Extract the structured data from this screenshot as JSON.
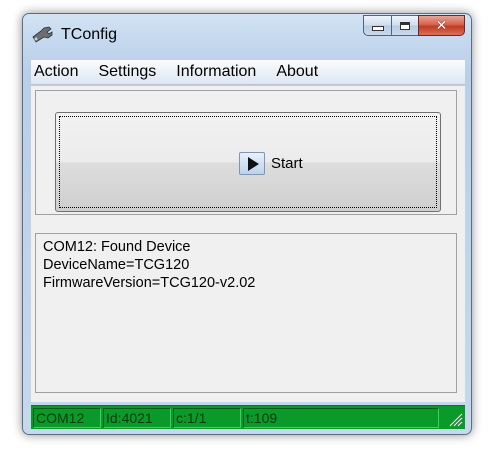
{
  "window": {
    "title": "TConfig",
    "app_icon": "wrench-icon",
    "close_glyph": "✕"
  },
  "menu": {
    "items": [
      "Action",
      "Settings",
      "Information",
      "About"
    ]
  },
  "start_button": {
    "label": "Start",
    "icon": "play-icon"
  },
  "log": {
    "lines": [
      "COM12: Found Device",
      "DeviceName=TCG120",
      "FirmwareVersion=TCG120-v2.02"
    ]
  },
  "status": {
    "cells": [
      "COM12",
      "Id:4021",
      "c:1/1",
      "t:109"
    ]
  },
  "colors": {
    "statusbar": "#0a9a2a",
    "client": "#f0f0f0",
    "close_button": "#c8452b"
  }
}
